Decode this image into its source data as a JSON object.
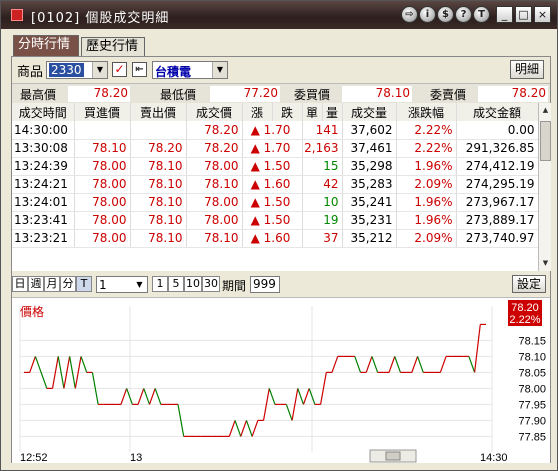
{
  "window": {
    "title": "[0102] 個股成交明細",
    "tool_buttons": [
      "⇨",
      "i",
      "$",
      "?",
      "T"
    ],
    "window_buttons": [
      "_",
      "□",
      "×"
    ]
  },
  "tabs": [
    {
      "label": "分時行情",
      "active": true
    },
    {
      "label": "歷史行情",
      "active": false
    }
  ],
  "selector": {
    "product_label": "商品",
    "code": "2330",
    "name": "台積電",
    "detail_button": "明細"
  },
  "info": {
    "high_label": "最高價",
    "high": "78.20",
    "low_label": "最低價",
    "low": "77.20",
    "bid_label": "委買價",
    "bid": "78.10",
    "ask_label": "委賣價",
    "ask": "78.20"
  },
  "table": {
    "headers": [
      "成交時間",
      "買進價",
      "賣出價",
      "成交價",
      "漲",
      "跌",
      "單",
      "量",
      "成交量",
      "漲跌幅",
      "成交金額"
    ],
    "rows": [
      {
        "time": "14:30:00",
        "buy": "",
        "sell": "",
        "price": "78.20",
        "chg": "▲ 1.70",
        "vol": "141",
        "total": "37,602",
        "pct": "2.22%",
        "amt": "0.00",
        "pc": "red",
        "vc": "red"
      },
      {
        "time": "13:30:08",
        "buy": "78.10",
        "sell": "78.20",
        "price": "78.20",
        "chg": "▲ 1.70",
        "vol": "2,163",
        "total": "37,461",
        "pct": "2.22%",
        "amt": "291,326.85",
        "pc": "red",
        "vc": "red"
      },
      {
        "time": "13:24:39",
        "buy": "78.00",
        "sell": "78.10",
        "price": "78.00",
        "chg": "▲ 1.50",
        "vol": "15",
        "total": "35,298",
        "pct": "1.96%",
        "amt": "274,412.19",
        "pc": "red",
        "vc": "green"
      },
      {
        "time": "13:24:21",
        "buy": "78.00",
        "sell": "78.10",
        "price": "78.10",
        "chg": "▲ 1.60",
        "vol": "42",
        "total": "35,283",
        "pct": "2.09%",
        "amt": "274,295.19",
        "pc": "red",
        "vc": "red"
      },
      {
        "time": "13:24:01",
        "buy": "78.00",
        "sell": "78.10",
        "price": "78.00",
        "chg": "▲ 1.50",
        "vol": "10",
        "total": "35,241",
        "pct": "1.96%",
        "amt": "273,967.17",
        "pc": "red",
        "vc": "green"
      },
      {
        "time": "13:23:41",
        "buy": "78.00",
        "sell": "78.10",
        "price": "78.00",
        "chg": "▲ 1.50",
        "vol": "19",
        "total": "35,231",
        "pct": "1.96%",
        "amt": "273,889.17",
        "pc": "red",
        "vc": "green"
      },
      {
        "time": "13:23:21",
        "buy": "78.00",
        "sell": "78.10",
        "price": "78.10",
        "chg": "▲ 1.60",
        "vol": "37",
        "total": "35,212",
        "pct": "2.09%",
        "amt": "273,740.97",
        "pc": "red",
        "vc": "red"
      }
    ]
  },
  "chart_toolbar": {
    "periods": [
      "日",
      "週",
      "月",
      "分",
      "T"
    ],
    "interval": "1",
    "zoom": [
      "1",
      "5",
      "10",
      "30"
    ],
    "range_label": "期間",
    "range_value": "999",
    "settings_button": "設定"
  },
  "chart_data": {
    "type": "line",
    "title": "價格",
    "last_price": "78.20",
    "last_pct": "2.22%",
    "x_tick_labels": [
      "12:52",
      "13",
      "14:30"
    ],
    "y_ticks": [
      78.15,
      78.1,
      78.05,
      78.0,
      77.95,
      77.9,
      77.85
    ],
    "ylim": [
      77.82,
      78.22
    ],
    "values": [
      78.05,
      78.05,
      78.1,
      78.05,
      78.0,
      78.0,
      78.1,
      78.0,
      78.1,
      78.0,
      78.1,
      78.05,
      78.05,
      77.95,
      77.95,
      77.95,
      77.95,
      77.95,
      78.0,
      77.95,
      77.95,
      78.0,
      77.95,
      78.0,
      77.95,
      77.95,
      77.95,
      77.95,
      77.85,
      77.85,
      77.85,
      77.85,
      77.85,
      77.85,
      77.85,
      77.85,
      77.85,
      77.9,
      77.85,
      77.9,
      77.85,
      77.9,
      77.9,
      78.0,
      77.95,
      77.95,
      77.95,
      77.9,
      78.0,
      77.95,
      78.0,
      77.95,
      77.95,
      78.05,
      78.05,
      78.1,
      78.1,
      78.1,
      78.1,
      78.05,
      78.05,
      78.1,
      78.05,
      78.05,
      78.05,
      78.1,
      78.05,
      78.05,
      78.05,
      78.1,
      78.05,
      78.05,
      78.05,
      78.05,
      78.1,
      78.1,
      78.1,
      78.1,
      78.1,
      78.05,
      78.2,
      78.2
    ],
    "colors": {
      "up": "#cc0000",
      "down": "#008000",
      "last_bg": "#cc0000"
    }
  }
}
